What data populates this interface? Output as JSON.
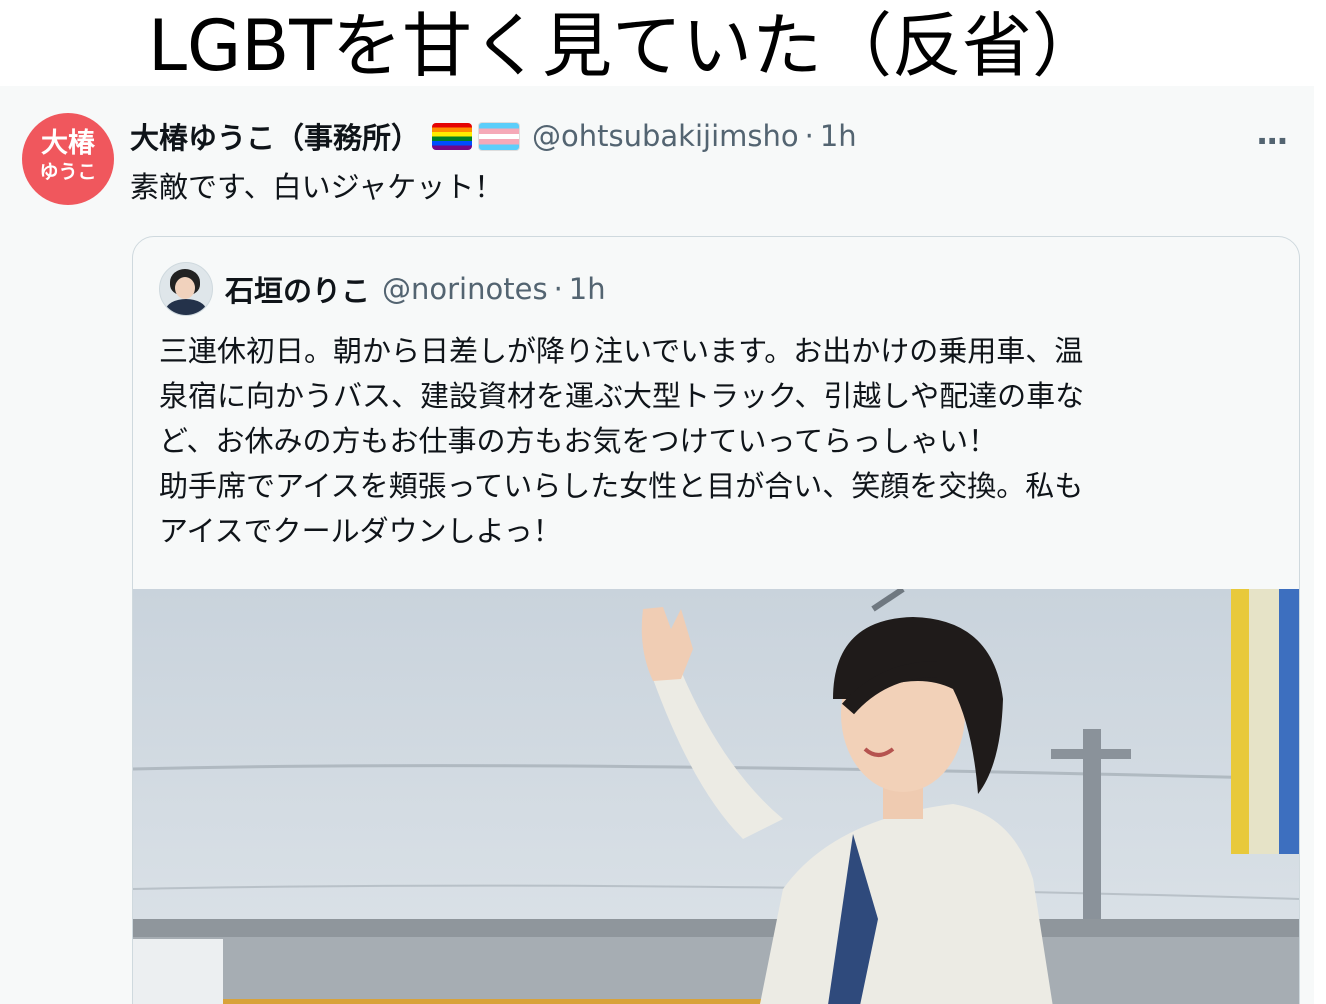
{
  "headline": "LGBTを甘く見ていた（反省）",
  "tweet": {
    "avatar_line1": "大椿",
    "avatar_line2": "ゆうこ",
    "author": "大椿ゆうこ（事務所）",
    "handle": "@ohtsubakijimsho",
    "separator": "·",
    "time": "1h",
    "flags": [
      "rainbow-flag-icon",
      "transgender-flag-icon"
    ],
    "more": "···",
    "text": "素敵です、白いジャケット！"
  },
  "quote": {
    "author": "石垣のりこ",
    "handle": "@norinotes",
    "separator": "·",
    "time": "1h",
    "lines": [
      "三連休初日。朝から日差しが降り注いでいます。お出かけの乗用車、温",
      "泉宿に向かうバス、建設資材を運ぶ大型トラック、引越しや配達の車な",
      "ど、お休みの方もお仕事の方もお気をつけていってらっしゃい！",
      "助手席でアイスを頬張っていらした女性と目が合い、笑顔を交換。私も",
      "アイスでクールダウンしよっ！"
    ]
  },
  "colors": {
    "avatar_bg": "#f0575d",
    "text": "#0f1419",
    "secondary": "#536471",
    "border": "#cfd9de"
  }
}
